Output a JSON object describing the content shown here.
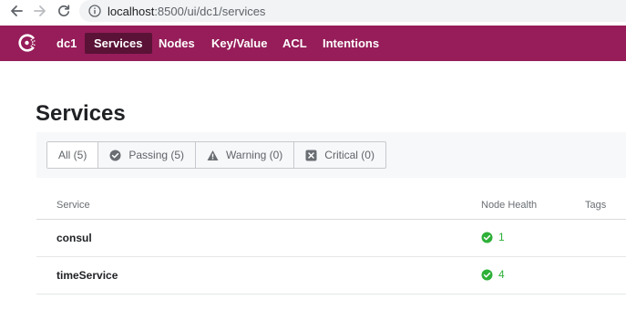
{
  "browser": {
    "url_host": "localhost",
    "url_path": ":8500/ui/dc1/services"
  },
  "header": {
    "datacenter": "dc1",
    "menu": [
      {
        "label": "Services",
        "active": true
      },
      {
        "label": "Nodes",
        "active": false
      },
      {
        "label": "Key/Value",
        "active": false
      },
      {
        "label": "ACL",
        "active": false
      },
      {
        "label": "Intentions",
        "active": false
      }
    ],
    "brand_color": "#961d59"
  },
  "main": {
    "title": "Services",
    "filters": [
      {
        "label": "All (5)",
        "icon": null,
        "active": true
      },
      {
        "label": "Passing (5)",
        "icon": "check-circle-icon",
        "active": false
      },
      {
        "label": "Warning (0)",
        "icon": "warning-triangle-icon",
        "active": false
      },
      {
        "label": "Critical (0)",
        "icon": "critical-x-icon",
        "active": false
      }
    ],
    "table": {
      "columns": [
        "Service",
        "Node Health",
        "Tags"
      ],
      "rows": [
        {
          "service": "consul",
          "node_health": "1",
          "status": "passing"
        },
        {
          "service": "timeService",
          "node_health": "4",
          "status": "passing"
        }
      ]
    },
    "passing_color": "#2eb039"
  }
}
